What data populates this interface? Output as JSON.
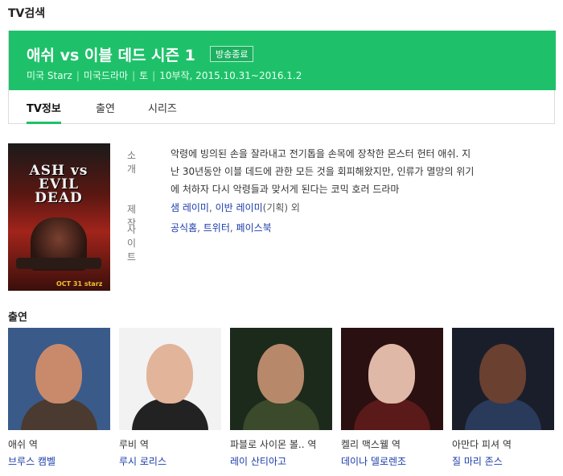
{
  "page": {
    "section_title": "TV검색"
  },
  "show": {
    "title": "애쉬 vs 이블 데드 시즌 1",
    "badge": "방송종료",
    "meta": [
      "미국 Starz",
      "미국드라마",
      "토",
      "10부작, 2015.10.31~2016.1.2"
    ]
  },
  "tabs": [
    {
      "label": "TV정보",
      "active": true
    },
    {
      "label": "출연",
      "active": false
    },
    {
      "label": "시리즈",
      "active": false
    }
  ],
  "poster": {
    "logo_line1": "ASH vs EVIL",
    "logo_line2": "DEAD",
    "footer": "OCT 31 starz"
  },
  "info": {
    "synopsis_label": "소개",
    "synopsis_line1": "악령에 빙의된 손을 잘라내고 전기톱을 손목에 장착한 몬스터 헌터 애쉬. 지",
    "synopsis_line2": "난 30년동안 이블 데드에 관한 모든 것을 회피해왔지만, 인류가 멸망의 위기",
    "synopsis_line3": "에 처하자 다시 악령들과 맞서게 된다는 코믹 호러 드라마",
    "production_label": "제작",
    "production_link1": "샘 레이미",
    "production_comma": ", ",
    "production_link2": "이반 레이미",
    "production_role": "(기획) 외",
    "site_label": "사이트",
    "site_links": [
      "공식홈",
      "트위터",
      "페이스북"
    ],
    "site_comma": ", "
  },
  "cast_section": {
    "title": "출연"
  },
  "cast": [
    {
      "role": "애쉬 역",
      "actor": "브루스 캠벨",
      "bg": "#3a5a8a",
      "skin": "#c88a6a",
      "cloth": "#4a3a30"
    },
    {
      "role": "루비 역",
      "actor": "루시 로리스",
      "bg": "#f2f2f2",
      "skin": "#e2b49a",
      "cloth": "#222222"
    },
    {
      "role": "파블로 사이몬 볼.. 역",
      "actor": "레이 산티아고",
      "bg": "#1c2a1c",
      "skin": "#b8886a",
      "cloth": "#3a4a2a"
    },
    {
      "role": "켈리 맥스웰 역",
      "actor": "데이나 델로렌조",
      "bg": "#2a1010",
      "skin": "#e0b8a8",
      "cloth": "#5a1a1a"
    },
    {
      "role": "아만다 피셔 역",
      "actor": "질 마리 존스",
      "bg": "#1a1e2a",
      "skin": "#6a4030",
      "cloth": "#2a3a5a"
    }
  ]
}
